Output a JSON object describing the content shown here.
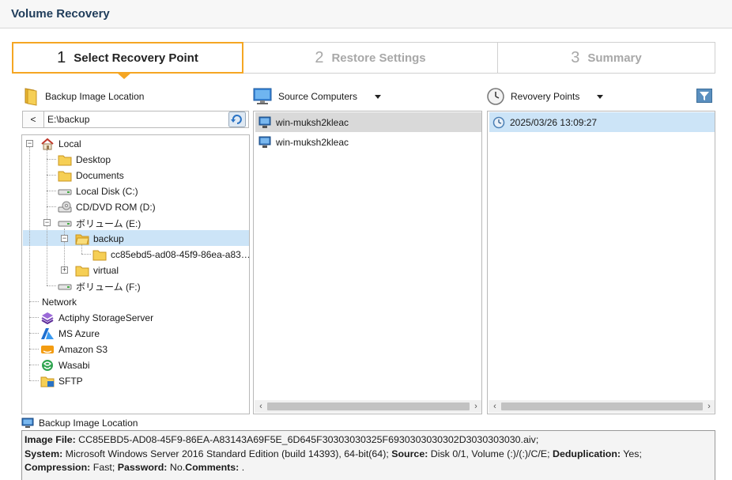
{
  "window": {
    "title": "Volume Recovery"
  },
  "wizard": {
    "steps": [
      {
        "num": "1",
        "label": "Select Recovery Point"
      },
      {
        "num": "2",
        "label": "Restore Settings"
      },
      {
        "num": "3",
        "label": "Summary"
      }
    ],
    "active_step": 1
  },
  "location_panel": {
    "header": "Backup Image Location",
    "back_label": "<",
    "path_value": "E:\\backup",
    "tree": {
      "local": "Local",
      "desktop": "Desktop",
      "documents": "Documents",
      "local_disk_c": "Local Disk (C:)",
      "cd_dvd_d": "CD/DVD ROM (D:)",
      "volume_e": "ボリューム (E:)",
      "backup": "backup",
      "backup_guid": "cc85ebd5-ad08-45f9-86ea-a83…",
      "virtual": "virtual",
      "volume_f": "ボリューム (F:)",
      "network": "Network",
      "actiphy": "Actiphy StorageServer",
      "azure": "MS Azure",
      "s3": "Amazon S3",
      "wasabi": "Wasabi",
      "sftp": "SFTP"
    }
  },
  "source_panel": {
    "header": "Source Computers",
    "items": [
      "win-muksh2kleac",
      "win-muksh2kleac"
    ]
  },
  "recovery_panel": {
    "header": "Revovery Points",
    "items": [
      "2025/03/26 13:09:27"
    ]
  },
  "info": {
    "label": "Backup Image Location",
    "image_file_label": "Image File:",
    "image_file_value": " CC85EBD5-AD08-45F9-86EA-A83143A69F5E_6D645F30303030325F6930303030302D3030303030.aiv;",
    "system_label": "System:",
    "system_value": " Microsoft Windows Server 2016 Standard Edition (build 14393), 64-bit(64); ",
    "source_label": "Source:",
    "source_value": " Disk 0/1, Volume (:)/(:)/C/E; ",
    "dedup_label": "Deduplication:",
    "dedup_value": " Yes;",
    "compression_label": "Compression:",
    "compression_value": " Fast; ",
    "password_label": "Password:",
    "password_value": " No.",
    "comments_label": "Comments:",
    "comments_value": " ."
  },
  "colors": {
    "accent": "#f5a623",
    "title": "#1f3c5a",
    "selection": "#cce4f7",
    "source_selection": "#d9d9d9"
  }
}
